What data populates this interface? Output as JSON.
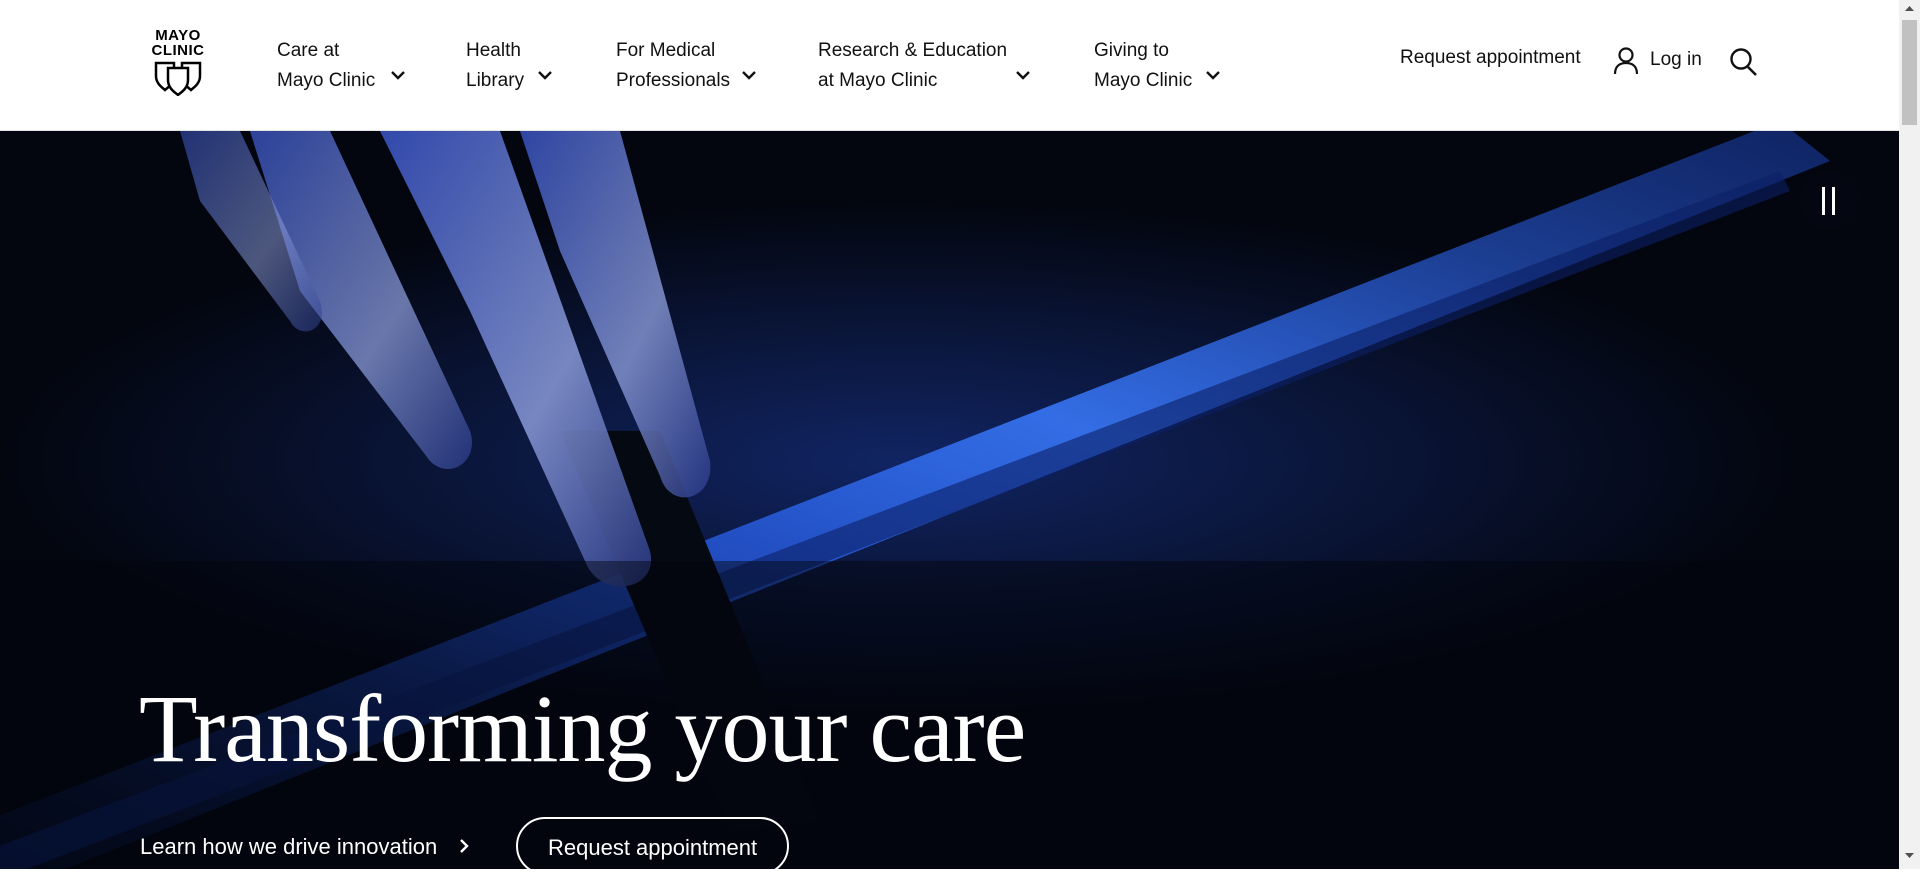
{
  "logo": {
    "line1": "MAYO",
    "line2": "CLINIC"
  },
  "nav": [
    {
      "line1": "Care at",
      "line2": "Mayo Clinic"
    },
    {
      "line1": "Health",
      "line2": "Library"
    },
    {
      "line1": "For Medical",
      "line2": "Professionals"
    },
    {
      "line1": "Research & Education",
      "line2": "at Mayo Clinic"
    },
    {
      "line1": "Giving to",
      "line2": "Mayo Clinic"
    }
  ],
  "utility": {
    "request_appointment": "Request appointment",
    "login": "Log in",
    "user_icon": "user-icon",
    "search_icon": "search-icon"
  },
  "hero": {
    "title": "Transforming your care",
    "link_label": "Learn how we drive innovation",
    "button_label": "Request appointment",
    "pause_icon": "pause-icon"
  },
  "colors": {
    "hero_bg": "#050a1a",
    "accent_blue": "#2f6fff",
    "text_dark": "#111111",
    "text_light": "#ffffff"
  }
}
